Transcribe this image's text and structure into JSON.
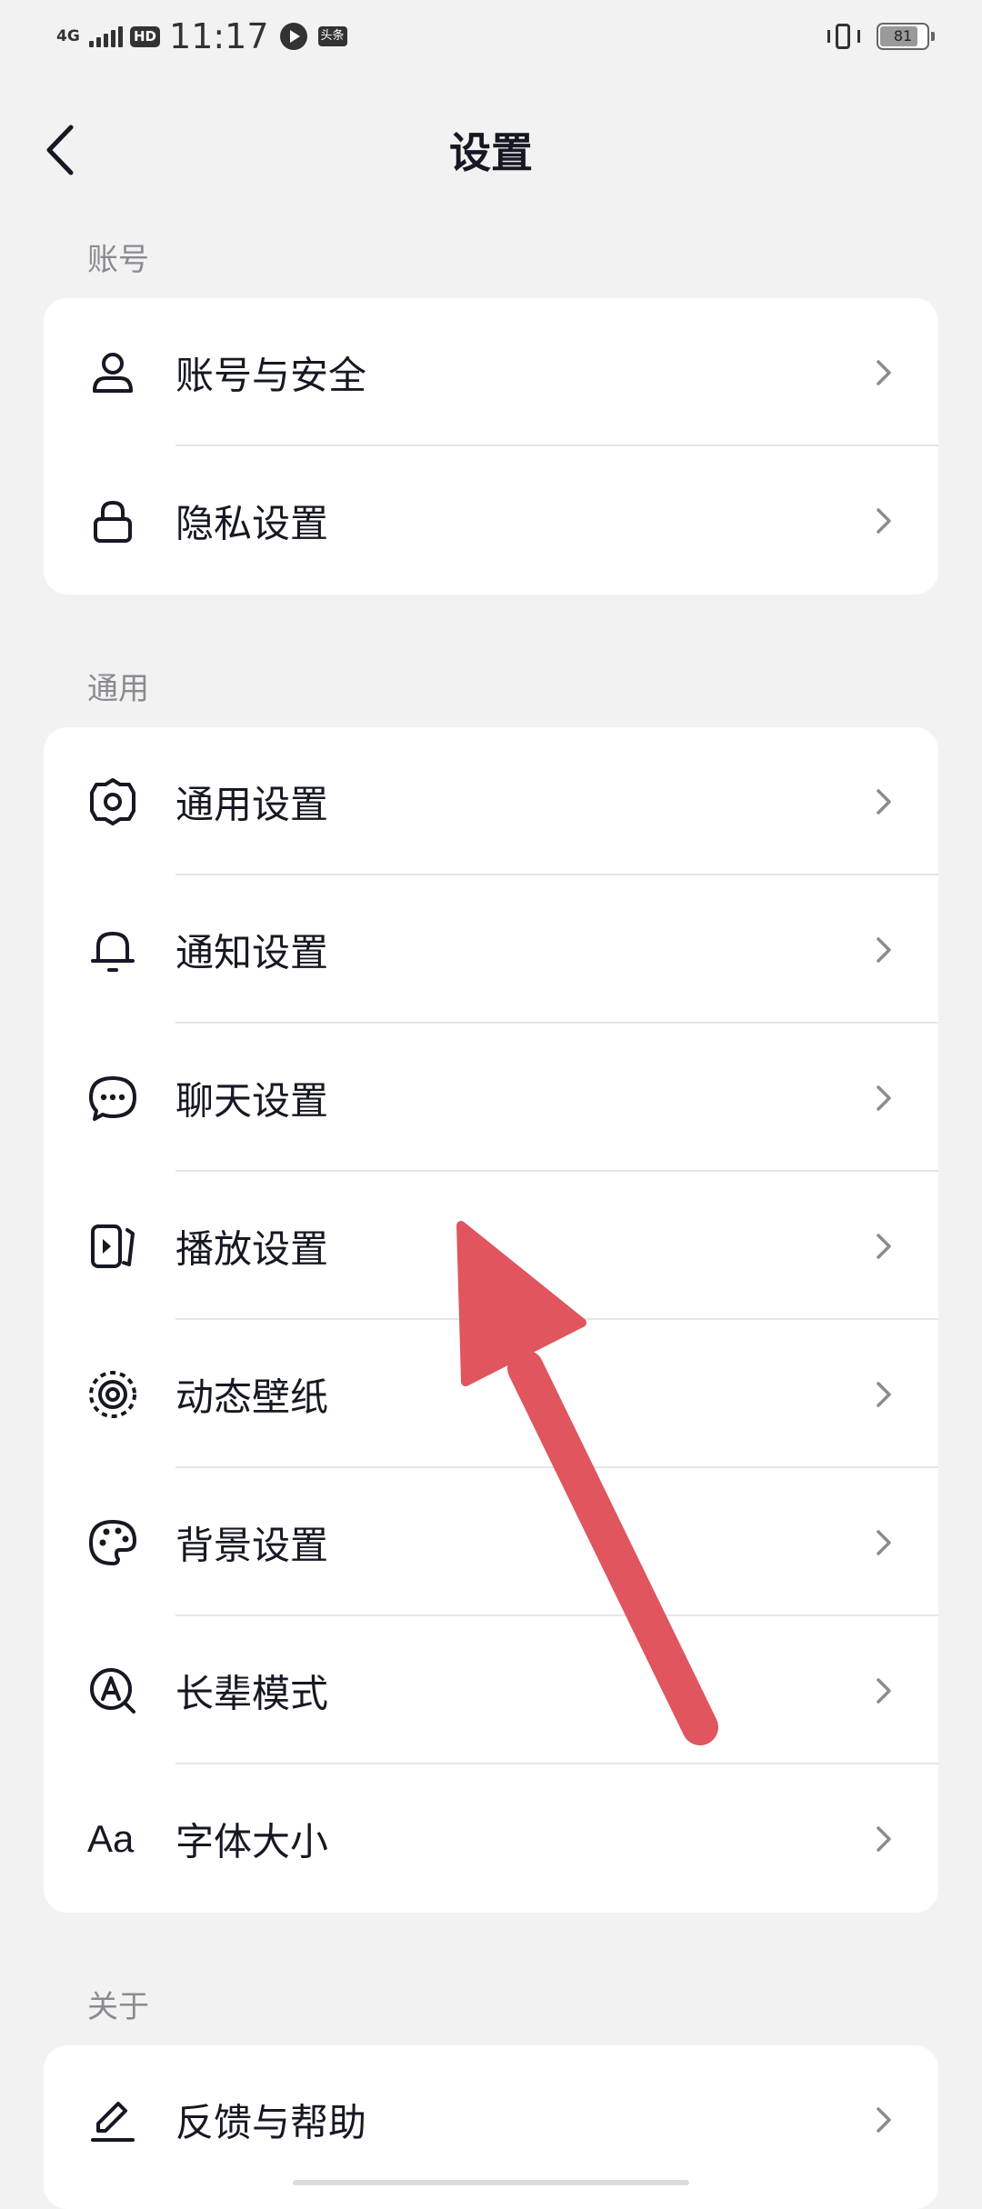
{
  "status_bar": {
    "network": "4G",
    "hd": "HD",
    "time": "11:17",
    "app_badge": "头条",
    "battery": "81",
    "battery_level": 0.81
  },
  "header": {
    "title": "设置",
    "back_icon": "chevron-left-icon"
  },
  "sections": [
    {
      "label": "账号",
      "items": [
        {
          "label": "账号与安全",
          "icon": "person-icon"
        },
        {
          "label": "隐私设置",
          "icon": "lock-icon"
        }
      ]
    },
    {
      "label": "通用",
      "items": [
        {
          "label": "通用设置",
          "icon": "gear-icon"
        },
        {
          "label": "通知设置",
          "icon": "bell-icon"
        },
        {
          "label": "聊天设置",
          "icon": "chat-bubble-icon"
        },
        {
          "label": "播放设置",
          "icon": "play-icon"
        },
        {
          "label": "动态壁纸",
          "icon": "live-wallpaper-icon"
        },
        {
          "label": "背景设置",
          "icon": "palette-icon"
        },
        {
          "label": "长辈模式",
          "icon": "elder-mode-icon"
        },
        {
          "label": "字体大小",
          "icon": "font-size-icon",
          "icon_text": "Aa"
        }
      ]
    },
    {
      "label": "关于",
      "items": [
        {
          "label": "反馈与帮助",
          "icon": "pencil-icon"
        }
      ]
    }
  ],
  "colors": {
    "background": "#f2f2f2",
    "card": "#ffffff",
    "text": "#161823",
    "section_label": "#8a8b91",
    "chevron": "#8a8b91",
    "annotation_arrow": "#e0555e"
  }
}
